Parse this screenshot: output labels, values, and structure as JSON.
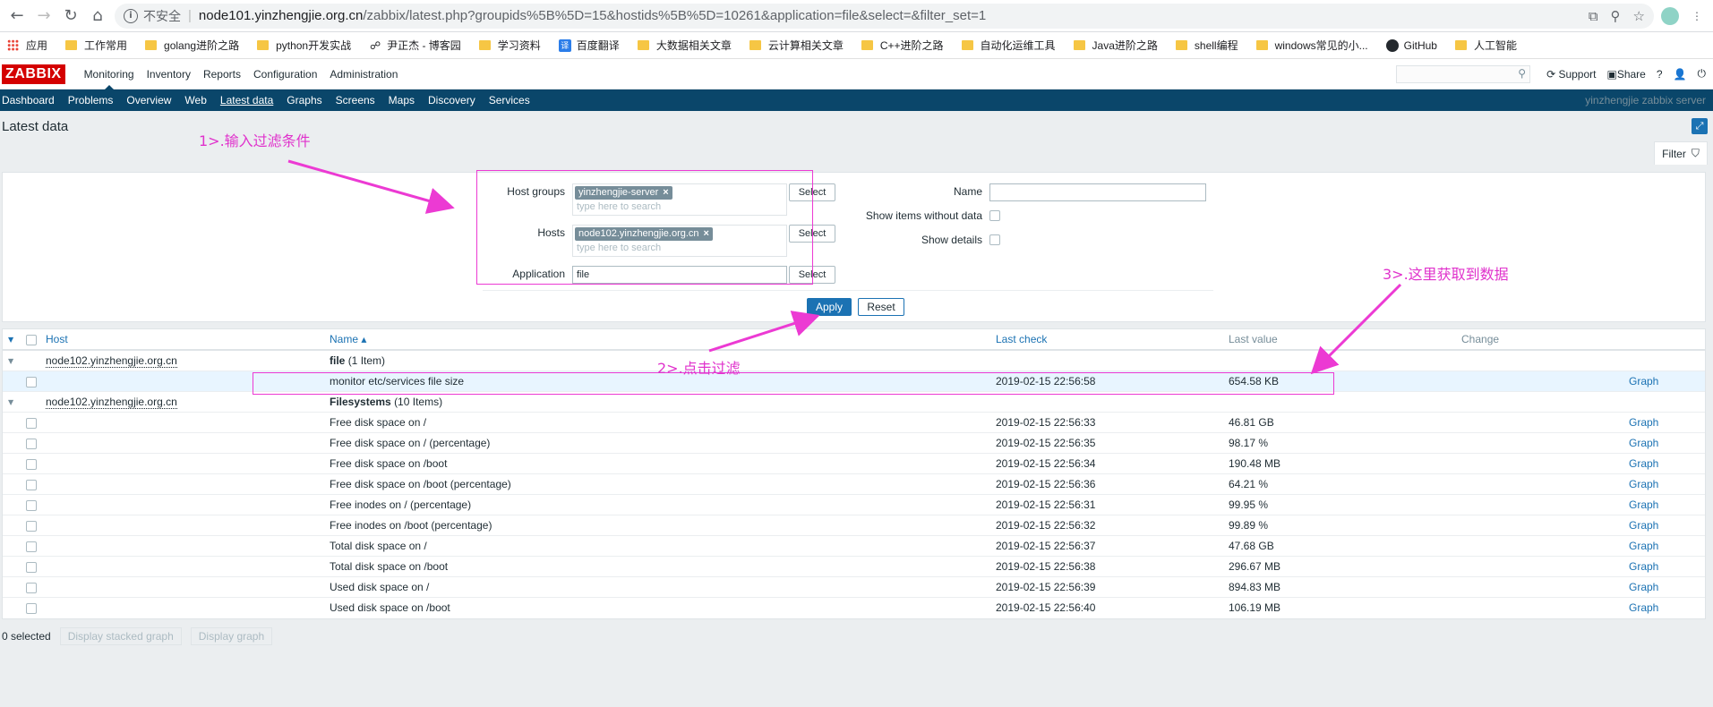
{
  "browser": {
    "insecure_label": "不安全",
    "url_host": "node101.yinzhengjie.org.cn",
    "url_path": "/zabbix/latest.php?groupids%5B%5D=15&hostids%5B%5D=10261&application=file&select=&filter_set=1",
    "bookmarks": [
      "应用",
      "工作常用",
      "golang进阶之路",
      "python开发实战",
      "尹正杰 - 博客园",
      "学习资料",
      "百度翻译",
      "大数据相关文章",
      "云计算相关文章",
      "C++进阶之路",
      "自动化运维工具",
      "Java进阶之路",
      "shell编程",
      "windows常见的小...",
      "GitHub",
      "人工智能"
    ]
  },
  "zabbix": {
    "logo": "ZABBIX",
    "main_menu": [
      "Monitoring",
      "Inventory",
      "Reports",
      "Configuration",
      "Administration"
    ],
    "top_right": {
      "support": "Support",
      "share": "Share",
      "help": "?"
    },
    "sub_menu": [
      "Dashboard",
      "Problems",
      "Overview",
      "Web",
      "Latest data",
      "Graphs",
      "Screens",
      "Maps",
      "Discovery",
      "Services"
    ],
    "server_name": "yinzhengjie zabbix server",
    "page_title": "Latest data",
    "filter_tab": "Filter"
  },
  "filter": {
    "host_groups_label": "Host groups",
    "host_groups_tag": "yinzhengjie-server",
    "hosts_label": "Hosts",
    "hosts_tag": "node102.yinzhengjie.org.cn",
    "placeholder": "type here to search",
    "application_label": "Application",
    "application_value": "file",
    "select_label": "Select",
    "name_label": "Name",
    "show_items_label": "Show items without data",
    "show_details_label": "Show details",
    "apply_label": "Apply",
    "reset_label": "Reset"
  },
  "table": {
    "headers": {
      "host": "Host",
      "name": "Name ▴",
      "last_check": "Last check",
      "last_value": "Last value",
      "change": "Change"
    },
    "groups": [
      {
        "host": "node102.yinzhengjie.org.cn",
        "app": "file",
        "count": "(1 Item)",
        "items": [
          {
            "name": "monitor etc/services file size",
            "check": "2019-02-15 22:56:58",
            "value": "654.58 KB",
            "graph": "Graph"
          }
        ]
      },
      {
        "host": "node102.yinzhengjie.org.cn",
        "app": "Filesystems",
        "count": "(10 Items)",
        "items": [
          {
            "name": "Free disk space on /",
            "check": "2019-02-15 22:56:33",
            "value": "46.81 GB",
            "graph": "Graph"
          },
          {
            "name": "Free disk space on / (percentage)",
            "check": "2019-02-15 22:56:35",
            "value": "98.17 %",
            "graph": "Graph"
          },
          {
            "name": "Free disk space on /boot",
            "check": "2019-02-15 22:56:34",
            "value": "190.48 MB",
            "graph": "Graph"
          },
          {
            "name": "Free disk space on /boot (percentage)",
            "check": "2019-02-15 22:56:36",
            "value": "64.21 %",
            "graph": "Graph"
          },
          {
            "name": "Free inodes on / (percentage)",
            "check": "2019-02-15 22:56:31",
            "value": "99.95 %",
            "graph": "Graph"
          },
          {
            "name": "Free inodes on /boot (percentage)",
            "check": "2019-02-15 22:56:32",
            "value": "99.89 %",
            "graph": "Graph"
          },
          {
            "name": "Total disk space on /",
            "check": "2019-02-15 22:56:37",
            "value": "47.68 GB",
            "graph": "Graph"
          },
          {
            "name": "Total disk space on /boot",
            "check": "2019-02-15 22:56:38",
            "value": "296.67 MB",
            "graph": "Graph"
          },
          {
            "name": "Used disk space on /",
            "check": "2019-02-15 22:56:39",
            "value": "894.83 MB",
            "graph": "Graph"
          },
          {
            "name": "Used disk space on /boot",
            "check": "2019-02-15 22:56:40",
            "value": "106.19 MB",
            "graph": "Graph"
          }
        ]
      }
    ]
  },
  "footer": {
    "selected": "0 selected",
    "stacked": "Display stacked graph",
    "graph": "Display graph"
  },
  "annotations": {
    "step1": "1>.输入过滤条件",
    "step2": "2>.点击过滤",
    "step3": "3>.这里获取到数据",
    "color": "#ec3ad3"
  }
}
